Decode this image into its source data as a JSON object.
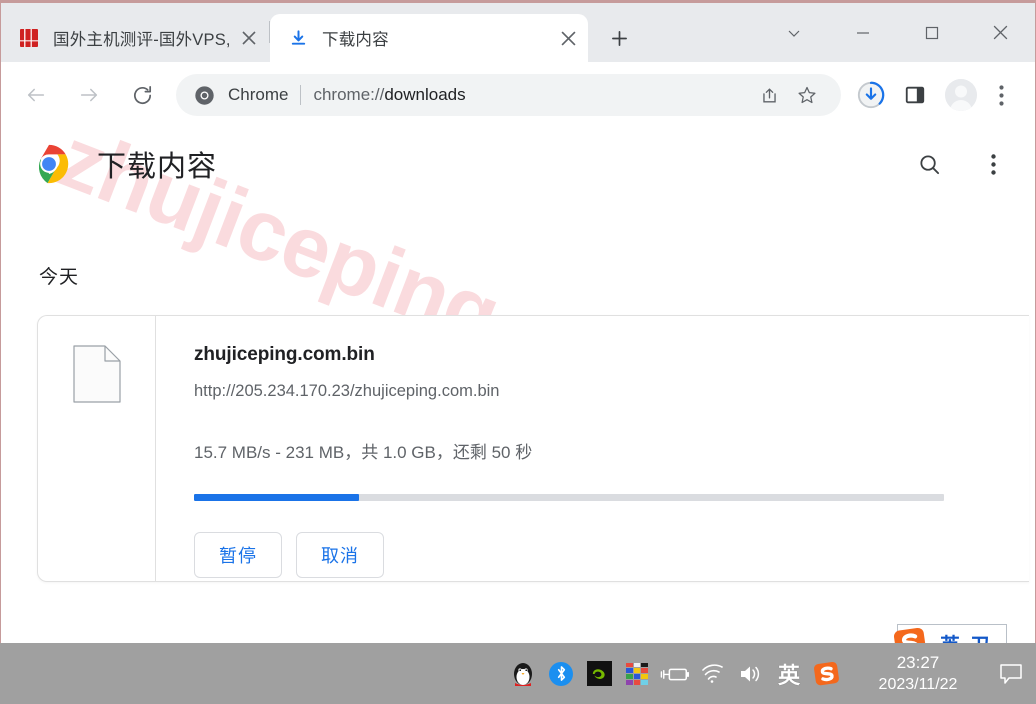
{
  "window": {
    "controls": [
      {
        "name": "tab-search",
        "glyph": "chevron-down"
      },
      {
        "name": "minimize",
        "glyph": "minimize"
      },
      {
        "name": "maximize",
        "glyph": "maximize"
      },
      {
        "name": "close",
        "glyph": "close"
      }
    ]
  },
  "tabs": [
    {
      "title": "国外主机测评-国外VPS,",
      "favicon": "red-site-icon",
      "active": false
    },
    {
      "title": "下载内容",
      "favicon": "download-arrow-icon",
      "active": true
    }
  ],
  "newtab_label": "+",
  "toolbar": {
    "back_icon": "back-arrow-icon",
    "forward_icon": "forward-arrow-icon",
    "reload_icon": "reload-icon",
    "omnibox": {
      "product": "Chrome",
      "scheme": "chrome://",
      "path": "downloads",
      "site_icon": "chrome-icon",
      "share_icon": "share-icon",
      "bookmark_icon": "star-icon"
    },
    "downloads_icon": "download-progress-icon",
    "side_panel_icon": "side-panel-icon",
    "profile_icon": "avatar-icon",
    "menu_icon": "three-dot-menu-icon"
  },
  "page": {
    "logo": "chrome-logo",
    "title": "下载内容",
    "search_icon": "search-icon",
    "menu_icon": "three-dot-menu-icon",
    "watermark": "zhujiceping.com",
    "section_label": "今天",
    "download": {
      "file_icon": "file-icon",
      "filename": "zhujiceping.com.bin",
      "url": "http://205.234.170.23/zhujiceping.com.bin",
      "status": "15.7 MB/s - 231 MB，共 1.0 GB，还剩 50 秒",
      "progress_percent": 22,
      "buttons": [
        {
          "label": "暂停",
          "name": "pause-button"
        },
        {
          "label": "取消",
          "name": "cancel-button"
        }
      ]
    }
  },
  "ime_bar": {
    "logo": "sogou-logo",
    "mode": "英",
    "extra": "ㄗ"
  },
  "taskbar": {
    "tray": [
      {
        "name": "qq-icon",
        "glyph": "🐧"
      },
      {
        "name": "bluetooth-icon",
        "glyph": "ᛒ"
      },
      {
        "name": "nvidia-icon",
        "glyph": "nvidia"
      },
      {
        "name": "color-grid-icon",
        "glyph": "grid"
      },
      {
        "name": "battery-charging-icon",
        "glyph": "battery"
      },
      {
        "name": "wifi-icon",
        "glyph": "wifi"
      },
      {
        "name": "volume-icon",
        "glyph": "volume"
      },
      {
        "name": "ime-indicator",
        "glyph": "英"
      },
      {
        "name": "sogou-icon",
        "glyph": "S"
      }
    ],
    "time": "23:27",
    "date": "2023/11/22",
    "notification_icon": "notification-icon"
  },
  "colors": {
    "accent_blue": "#1a73e8",
    "tabstrip_bg": "#e8eaed",
    "taskbar_bg": "#a0a0a0",
    "watermark_pink": "#fadadd",
    "progress_track": "#dadce0",
    "sogou_orange": "#f4681c"
  }
}
